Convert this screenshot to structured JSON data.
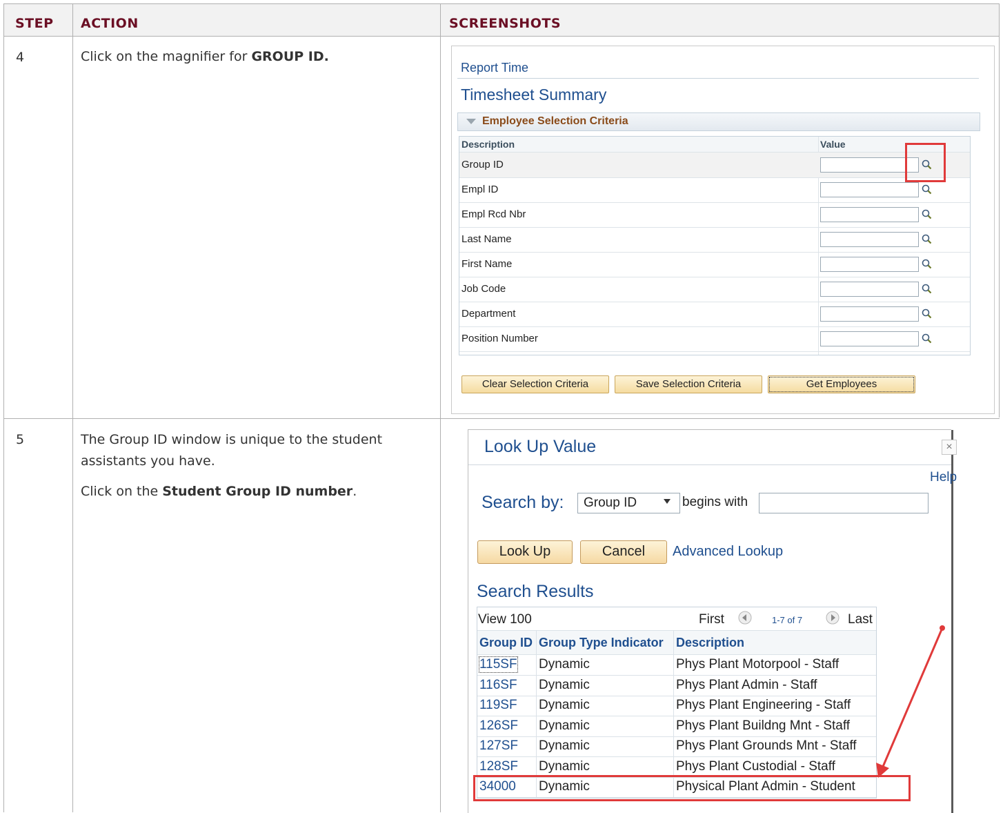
{
  "table": {
    "headers": [
      "STEP",
      "ACTION",
      "SCREENSHOTS"
    ],
    "rows": [
      {
        "step": "4",
        "action_pre": "Click on the magnifier for ",
        "action_bold": "GROUP ID."
      },
      {
        "step": "5",
        "action_line1": "The Group ID window is unique to the student",
        "action_line2": "assistants you have.",
        "action_line3_pre": "Click on the ",
        "action_line3_bold": "Student Group ID number",
        "action_line3_post": "."
      }
    ]
  },
  "shot1": {
    "breadcrumb": "Report Time",
    "page_title": "Timesheet Summary",
    "section_title": "Employee Selection Criteria",
    "col_description": "Description",
    "col_value": "Value",
    "fields": [
      "Group ID",
      "Empl ID",
      "Empl Rcd Nbr",
      "Last Name",
      "First Name",
      "Job Code",
      "Department",
      "Position Number"
    ],
    "buttons": [
      "Clear Selection Criteria",
      "Save Selection Criteria",
      "Get Employees"
    ],
    "highlight_color": "#e03a3a",
    "accent_color": "#1f4f8f"
  },
  "shot2": {
    "title": "Look Up Value",
    "help": "Help",
    "search_by_label": "Search by:",
    "search_field": "Group ID",
    "operator": "begins with",
    "search_value": "",
    "btn_lookup": "Look Up",
    "btn_cancel": "Cancel",
    "advanced_lookup": "Advanced Lookup",
    "results_title": "Search Results",
    "view_label": "View 100",
    "first": "First",
    "range": "1-7 of 7",
    "last": "Last",
    "col_group_id": "Group ID",
    "col_type": "Group Type Indicator",
    "col_desc": "Description",
    "results": [
      {
        "id": "115SF",
        "type": "Dynamic",
        "desc": "Phys Plant Motorpool - Staff"
      },
      {
        "id": "116SF",
        "type": "Dynamic",
        "desc": "Phys Plant Admin - Staff"
      },
      {
        "id": "119SF",
        "type": "Dynamic",
        "desc": "Phys Plant Engineering - Staff"
      },
      {
        "id": "126SF",
        "type": "Dynamic",
        "desc": "Phys Plant Buildng Mnt - Staff"
      },
      {
        "id": "127SF",
        "type": "Dynamic",
        "desc": "Phys Plant Grounds Mnt - Staff"
      },
      {
        "id": "128SF",
        "type": "Dynamic",
        "desc": "Phys Plant Custodial - Staff"
      },
      {
        "id": "34000",
        "type": "Dynamic",
        "desc": "Physical Plant Admin - Student"
      }
    ]
  }
}
